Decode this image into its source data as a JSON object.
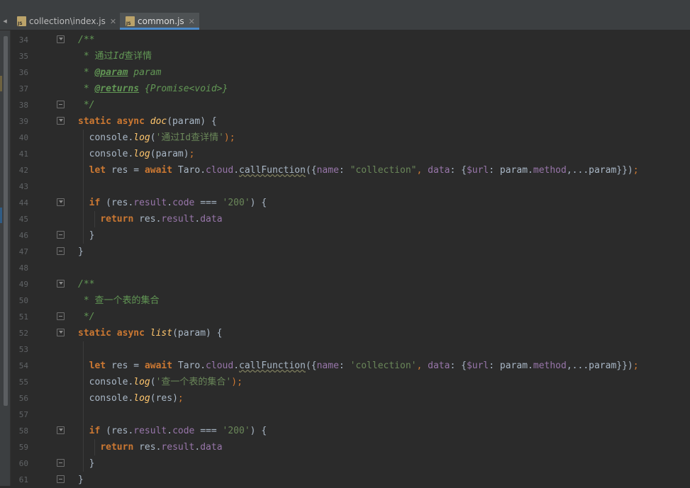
{
  "tabs": [
    {
      "label": "collection\\index.js",
      "active": false
    },
    {
      "label": "common.js",
      "active": true
    }
  ],
  "icons": {
    "tab": "js-file-icon",
    "close": "close-icon"
  },
  "colors": {
    "keyword": "#cc7832",
    "comment": "#629755",
    "string": "#6a8759",
    "function": "#ffc66d",
    "property": "#9876aa",
    "text": "#a9b7c6",
    "background": "#2b2b2b"
  },
  "lines": [
    {
      "n": "34",
      "fold": "open",
      "tokens": [
        {
          "t": "/**",
          "c": "cm"
        }
      ]
    },
    {
      "n": "35",
      "fold": "",
      "tokens": [
        {
          "t": " * ",
          "c": "cm"
        },
        {
          "t": "通过",
          "c": "cmcn"
        },
        {
          "t": "Id",
          "c": "cm"
        },
        {
          "t": "查详情",
          "c": "cmcn"
        }
      ]
    },
    {
      "n": "36",
      "fold": "",
      "tokens": [
        {
          "t": " * ",
          "c": "cm"
        },
        {
          "t": "@param",
          "c": "tag"
        },
        {
          "t": " param",
          "c": "cm"
        }
      ]
    },
    {
      "n": "37",
      "fold": "",
      "tokens": [
        {
          "t": " * ",
          "c": "cm"
        },
        {
          "t": "@returns",
          "c": "tag"
        },
        {
          "t": " {Promise<void>}",
          "c": "cm"
        }
      ]
    },
    {
      "n": "38",
      "fold": "close",
      "tokens": [
        {
          "t": " */",
          "c": "cm"
        }
      ]
    },
    {
      "n": "39",
      "fold": "open",
      "tokens": [
        {
          "t": "static async ",
          "c": "kw"
        },
        {
          "t": "doc",
          "c": "fn"
        },
        {
          "t": "(param) {",
          "c": ""
        }
      ]
    },
    {
      "n": "40",
      "fold": "",
      "tokens": [
        {
          "t": "  console.",
          "c": ""
        },
        {
          "t": "log",
          "c": "fn"
        },
        {
          "t": "(",
          "c": ""
        },
        {
          "t": "'通过Id查详情'",
          "c": "str"
        },
        {
          "t": ");",
          "c": "pun"
        }
      ]
    },
    {
      "n": "41",
      "fold": "",
      "tokens": [
        {
          "t": "  console.",
          "c": ""
        },
        {
          "t": "log",
          "c": "fn"
        },
        {
          "t": "(param)",
          "c": ""
        },
        {
          "t": ";",
          "c": "pun"
        }
      ]
    },
    {
      "n": "42",
      "fold": "",
      "tokens": [
        {
          "t": "  ",
          "c": ""
        },
        {
          "t": "let ",
          "c": "kw"
        },
        {
          "t": "res = ",
          "c": ""
        },
        {
          "t": "await ",
          "c": "kw"
        },
        {
          "t": "Taro.",
          "c": ""
        },
        {
          "t": "cloud",
          "c": "prop"
        },
        {
          "t": ".",
          "c": ""
        },
        {
          "t": "callFunction",
          "c": "squig"
        },
        {
          "t": "({",
          "c": ""
        },
        {
          "t": "name",
          "c": "prop"
        },
        {
          "t": ": ",
          "c": ""
        },
        {
          "t": "\"collection\"",
          "c": "str"
        },
        {
          "t": ", ",
          "c": "pun"
        },
        {
          "t": "data",
          "c": "prop"
        },
        {
          "t": ": {",
          "c": ""
        },
        {
          "t": "$url",
          "c": "prop"
        },
        {
          "t": ": param.",
          "c": ""
        },
        {
          "t": "method",
          "c": "prop"
        },
        {
          "t": ",...param}})",
          "c": ""
        },
        {
          "t": ";",
          "c": "pun"
        }
      ]
    },
    {
      "n": "43",
      "fold": "",
      "tokens": []
    },
    {
      "n": "44",
      "fold": "open",
      "tokens": [
        {
          "t": "  ",
          "c": ""
        },
        {
          "t": "if ",
          "c": "kw"
        },
        {
          "t": "(res.",
          "c": ""
        },
        {
          "t": "result",
          "c": "prop"
        },
        {
          "t": ".",
          "c": ""
        },
        {
          "t": "code",
          "c": "prop"
        },
        {
          "t": " === ",
          "c": ""
        },
        {
          "t": "'200'",
          "c": "str"
        },
        {
          "t": ") {",
          "c": ""
        }
      ]
    },
    {
      "n": "45",
      "fold": "",
      "tokens": [
        {
          "t": "    ",
          "c": ""
        },
        {
          "t": "return ",
          "c": "kw"
        },
        {
          "t": "res.",
          "c": ""
        },
        {
          "t": "result",
          "c": "prop"
        },
        {
          "t": ".",
          "c": ""
        },
        {
          "t": "data",
          "c": "prop"
        }
      ]
    },
    {
      "n": "46",
      "fold": "close",
      "tokens": [
        {
          "t": "  }",
          "c": ""
        }
      ]
    },
    {
      "n": "47",
      "fold": "close",
      "tokens": [
        {
          "t": "}",
          "c": ""
        }
      ]
    },
    {
      "n": "48",
      "fold": "",
      "tokens": []
    },
    {
      "n": "49",
      "fold": "open",
      "tokens": [
        {
          "t": "/**",
          "c": "cm"
        }
      ]
    },
    {
      "n": "50",
      "fold": "",
      "tokens": [
        {
          "t": " * ",
          "c": "cm"
        },
        {
          "t": "查一个表的集合",
          "c": "cmcn"
        }
      ]
    },
    {
      "n": "51",
      "fold": "close",
      "tokens": [
        {
          "t": " */",
          "c": "cm"
        }
      ]
    },
    {
      "n": "52",
      "fold": "open",
      "tokens": [
        {
          "t": "static async ",
          "c": "kw"
        },
        {
          "t": "list",
          "c": "fn"
        },
        {
          "t": "(param) {",
          "c": ""
        }
      ]
    },
    {
      "n": "53",
      "fold": "",
      "tokens": []
    },
    {
      "n": "54",
      "fold": "",
      "tokens": [
        {
          "t": "  ",
          "c": ""
        },
        {
          "t": "let ",
          "c": "kw"
        },
        {
          "t": "res = ",
          "c": ""
        },
        {
          "t": "await ",
          "c": "kw"
        },
        {
          "t": "Taro.",
          "c": ""
        },
        {
          "t": "cloud",
          "c": "prop"
        },
        {
          "t": ".",
          "c": ""
        },
        {
          "t": "callFunction",
          "c": "squig"
        },
        {
          "t": "({",
          "c": ""
        },
        {
          "t": "name",
          "c": "prop"
        },
        {
          "t": ": ",
          "c": ""
        },
        {
          "t": "'collection'",
          "c": "str"
        },
        {
          "t": ", ",
          "c": "pun"
        },
        {
          "t": "data",
          "c": "prop"
        },
        {
          "t": ": {",
          "c": ""
        },
        {
          "t": "$url",
          "c": "prop"
        },
        {
          "t": ": param.",
          "c": ""
        },
        {
          "t": "method",
          "c": "prop"
        },
        {
          "t": ",...param}})",
          "c": ""
        },
        {
          "t": ";",
          "c": "pun"
        }
      ]
    },
    {
      "n": "55",
      "fold": "",
      "tokens": [
        {
          "t": "  console.",
          "c": ""
        },
        {
          "t": "log",
          "c": "fn"
        },
        {
          "t": "(",
          "c": ""
        },
        {
          "t": "'查一个表的集合'",
          "c": "str"
        },
        {
          "t": ");",
          "c": "pun"
        }
      ]
    },
    {
      "n": "56",
      "fold": "",
      "tokens": [
        {
          "t": "  console.",
          "c": ""
        },
        {
          "t": "log",
          "c": "fn"
        },
        {
          "t": "(res)",
          "c": ""
        },
        {
          "t": ";",
          "c": "pun"
        }
      ]
    },
    {
      "n": "57",
      "fold": "",
      "tokens": []
    },
    {
      "n": "58",
      "fold": "open",
      "tokens": [
        {
          "t": "  ",
          "c": ""
        },
        {
          "t": "if ",
          "c": "kw"
        },
        {
          "t": "(res.",
          "c": ""
        },
        {
          "t": "result",
          "c": "prop"
        },
        {
          "t": ".",
          "c": ""
        },
        {
          "t": "code",
          "c": "prop"
        },
        {
          "t": " === ",
          "c": ""
        },
        {
          "t": "'200'",
          "c": "str"
        },
        {
          "t": ") {",
          "c": ""
        }
      ]
    },
    {
      "n": "59",
      "fold": "",
      "tokens": [
        {
          "t": "    ",
          "c": ""
        },
        {
          "t": "return ",
          "c": "kw"
        },
        {
          "t": "res.",
          "c": ""
        },
        {
          "t": "result",
          "c": "prop"
        },
        {
          "t": ".",
          "c": ""
        },
        {
          "t": "data",
          "c": "prop"
        }
      ]
    },
    {
      "n": "60",
      "fold": "close",
      "tokens": [
        {
          "t": "  }",
          "c": ""
        }
      ]
    },
    {
      "n": "61",
      "fold": "close",
      "tokens": [
        {
          "t": "}",
          "c": ""
        }
      ]
    }
  ]
}
